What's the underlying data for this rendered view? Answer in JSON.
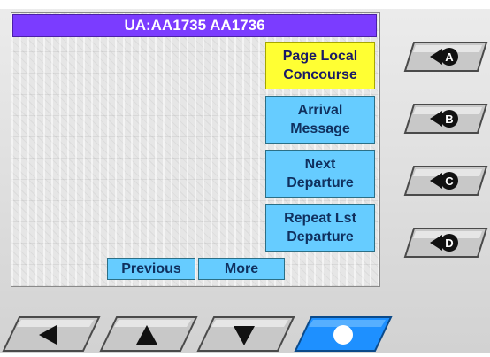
{
  "screen": {
    "title": "UA:AA1735 AA1736"
  },
  "softkeys": [
    {
      "label": "Page Local\nConcourse",
      "selected": true
    },
    {
      "label": "Arrival\nMessage",
      "selected": false
    },
    {
      "label": "Next\nDeparture",
      "selected": false
    },
    {
      "label": "Repeat Lst\nDeparture",
      "selected": false
    }
  ],
  "nav": {
    "previous_label": "Previous",
    "more_label": "More"
  },
  "side_buttons": [
    {
      "letter": "A",
      "icon": "arrow-a-icon"
    },
    {
      "letter": "B",
      "icon": "arrow-b-icon"
    },
    {
      "letter": "C",
      "icon": "arrow-c-icon"
    },
    {
      "letter": "D",
      "icon": "arrow-d-icon"
    }
  ],
  "bottom_buttons": [
    {
      "icon": "left-arrow-icon"
    },
    {
      "icon": "up-arrow-icon"
    },
    {
      "icon": "down-arrow-icon"
    },
    {
      "icon": "select-dot-icon"
    }
  ],
  "colors": {
    "title_bar": "#7b3cff",
    "softkey": "#66ccff",
    "softkey_selected": "#ffff33",
    "active_hw_button": "#1e90ff"
  }
}
